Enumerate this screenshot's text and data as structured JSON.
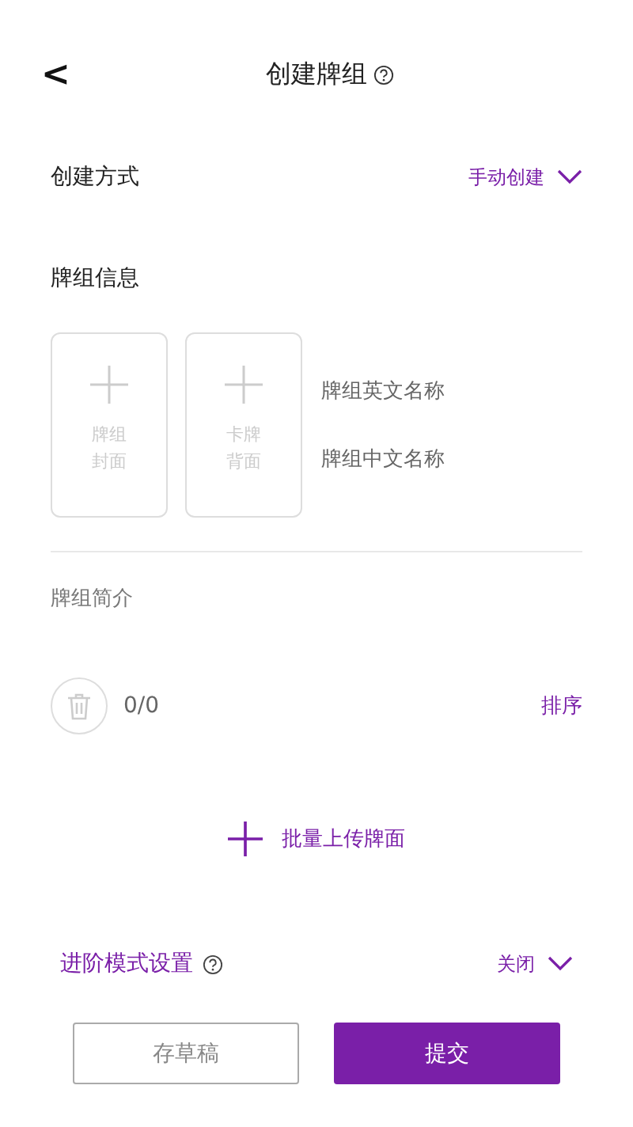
{
  "header": {
    "back": "<",
    "title": "创建牌组"
  },
  "create_mode": {
    "label": "创建方式",
    "value": "手动创建"
  },
  "deck_info": {
    "heading": "牌组信息",
    "uploads": [
      {
        "label": "牌组封面"
      },
      {
        "label": "卡牌背面"
      }
    ],
    "name_fields": [
      {
        "placeholder": "牌组英文名称"
      },
      {
        "placeholder": "牌组中文名称"
      }
    ],
    "intro_placeholder": "牌组简介"
  },
  "cards": {
    "count": "0/0",
    "sort": "排序",
    "batch_upload": "批量上传牌面"
  },
  "advanced": {
    "label": "进阶模式设置",
    "value": "关闭"
  },
  "buttons": [
    {
      "label": "存草稿",
      "kind": "outline"
    },
    {
      "label": "提交",
      "kind": "primary"
    }
  ]
}
